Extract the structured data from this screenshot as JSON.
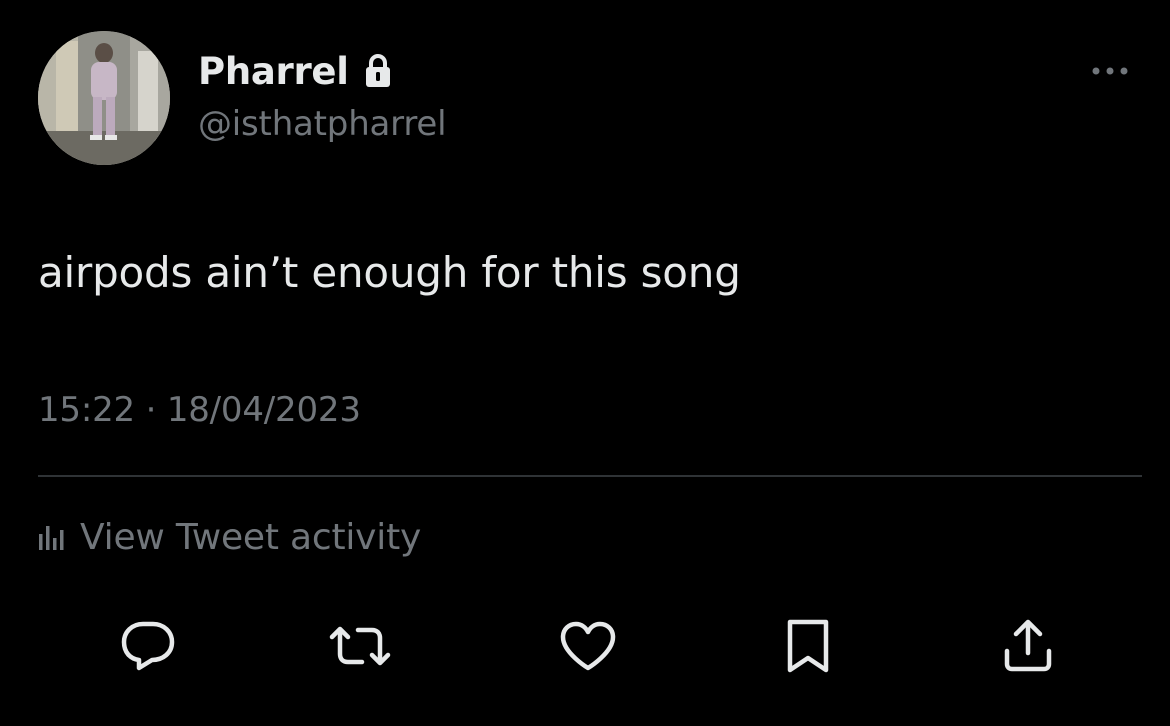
{
  "tweet": {
    "display_name": "Pharrel",
    "handle": "@isthatpharrel",
    "text": "airpods ain’t enough for this song",
    "time": "15:22",
    "separator": "·",
    "date": "18/04/2023",
    "activity_label": "View Tweet activity",
    "protected_account": true
  },
  "actions": [
    {
      "name": "reply",
      "icon": "comment-icon"
    },
    {
      "name": "retweet",
      "icon": "retweet-icon"
    },
    {
      "name": "like",
      "icon": "heart-icon"
    },
    {
      "name": "bookmark",
      "icon": "bookmark-icon"
    },
    {
      "name": "share",
      "icon": "share-icon"
    }
  ],
  "colors": {
    "background": "#000000",
    "primary_text": "#e7e9ea",
    "secondary_text": "#71767b",
    "divider": "#2f3336"
  }
}
